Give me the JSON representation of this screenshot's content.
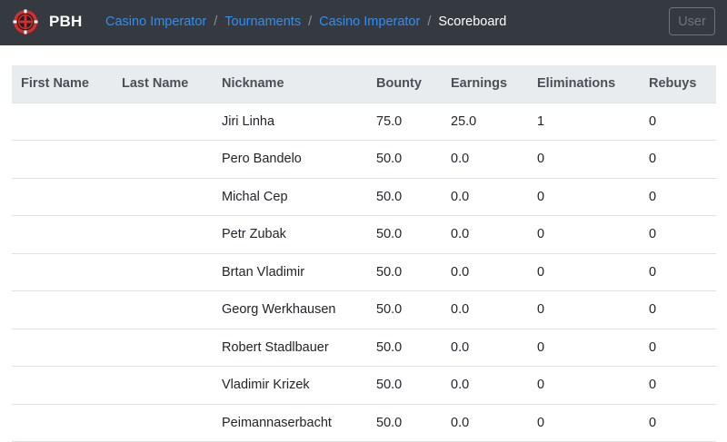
{
  "navbar": {
    "brand": "PBH",
    "logo": "poker-chip-logo",
    "breadcrumb": {
      "items": [
        "Casino Imperator",
        "Tournaments",
        "Casino Imperator"
      ],
      "separator": "/",
      "active": "Scoreboard"
    },
    "user_label": "User",
    "colors": {
      "background": "#343a40",
      "link": "#2f8ef7",
      "logo_red": "#d32f2f"
    }
  },
  "table": {
    "headers": [
      "First Name",
      "Last Name",
      "Nickname",
      "Bounty",
      "Earnings",
      "Eliminations",
      "Rebuys"
    ],
    "rows": [
      [
        "",
        "",
        "Jiri Linha",
        "75.0",
        "25.0",
        "1",
        "0"
      ],
      [
        "",
        "",
        "Pero Bandelo",
        "50.0",
        "0.0",
        "0",
        "0"
      ],
      [
        "",
        "",
        "Michal Cep",
        "50.0",
        "0.0",
        "0",
        "0"
      ],
      [
        "",
        "",
        "Petr Zubak",
        "50.0",
        "0.0",
        "0",
        "0"
      ],
      [
        "",
        "",
        "Brtan Vladimir",
        "50.0",
        "0.0",
        "0",
        "0"
      ],
      [
        "",
        "",
        "Georg Werkhausen",
        "50.0",
        "0.0",
        "0",
        "0"
      ],
      [
        "",
        "",
        "Robert Stadlbauer",
        "50.0",
        "0.0",
        "0",
        "0"
      ],
      [
        "",
        "",
        "Vladimir Krizek",
        "50.0",
        "0.0",
        "0",
        "0"
      ],
      [
        "",
        "",
        "Peimannaserbacht",
        "50.0",
        "0.0",
        "0",
        "0"
      ]
    ]
  }
}
